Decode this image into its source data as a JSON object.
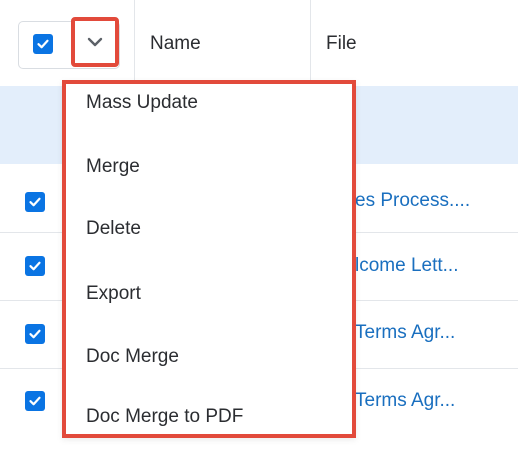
{
  "header": {
    "name_label": "Name",
    "file_label": "File"
  },
  "rows": [
    {
      "file_text": "es Process...."
    },
    {
      "file_text": "lcome Lett..."
    },
    {
      "file_text": "Terms Agr..."
    },
    {
      "file_text": "Terms Agr..."
    }
  ],
  "menu": {
    "items": [
      "Mass Update",
      "Merge",
      "Delete",
      "Export",
      "Doc Merge",
      "Doc Merge to PDF"
    ]
  },
  "colors": {
    "accent": "#0a74e3",
    "highlight_border": "#e24a3b",
    "link": "#1a6fbf",
    "selected_row": "#e3eefb"
  },
  "icons": [
    "checkmark-icon",
    "chevron-down-icon"
  ]
}
